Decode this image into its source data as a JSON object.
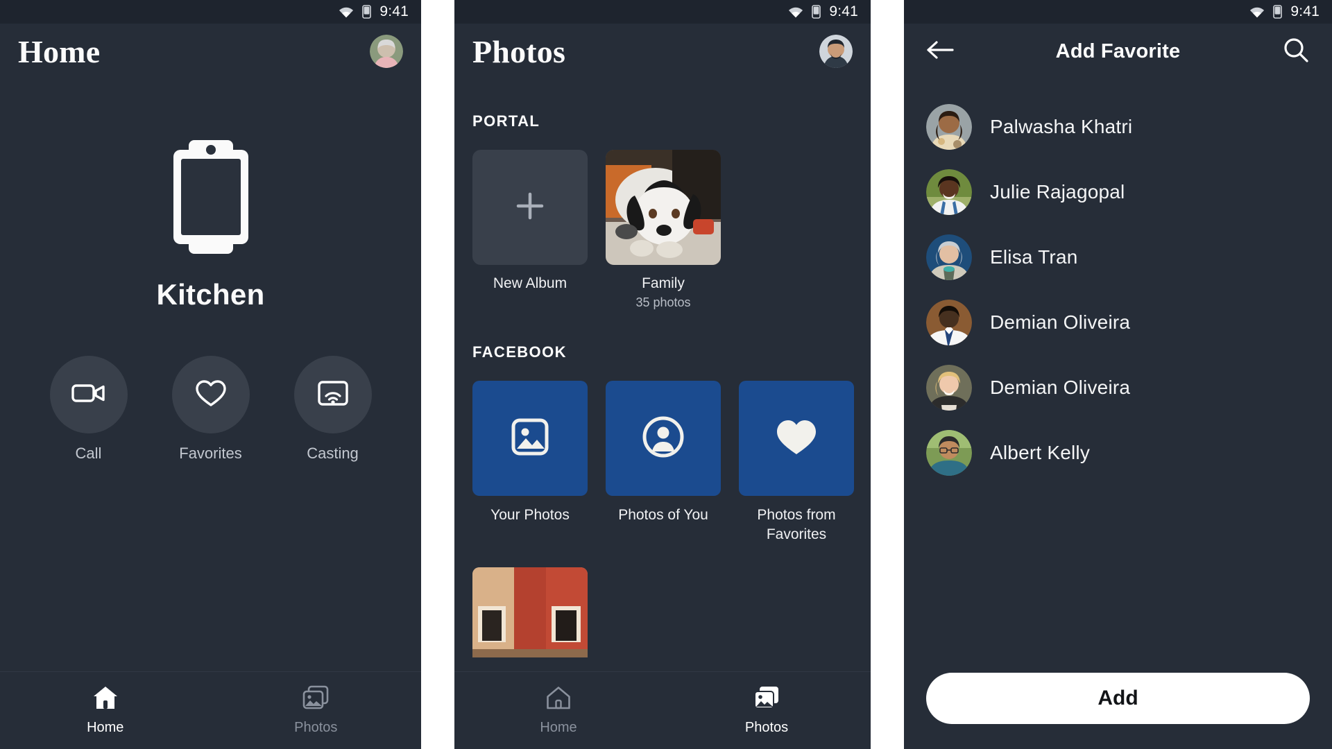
{
  "status_bar": {
    "time": "9:41",
    "wifi_icon": "wifi-icon",
    "battery_icon": "battery-icon"
  },
  "panels": [
    {
      "id": "home",
      "app_bar": {
        "title": "Home",
        "avatar_icon": "user-avatar"
      },
      "device": {
        "illustration_icon": "portal-device-icon",
        "room_name": "Kitchen"
      },
      "actions": [
        {
          "label": "Call",
          "icon": "video-camera-icon"
        },
        {
          "label": "Favorites",
          "icon": "heart-outline-icon"
        },
        {
          "label": "Casting",
          "icon": "cast-screen-icon"
        }
      ],
      "bottom_nav": [
        {
          "label": "Home",
          "icon": "home-icon",
          "active": true
        },
        {
          "label": "Photos",
          "icon": "photos-stack-icon",
          "active": false
        }
      ]
    },
    {
      "id": "photos",
      "app_bar": {
        "title": "Photos",
        "avatar_icon": "user-avatar"
      },
      "sections": [
        {
          "heading": "PORTAL",
          "albums": [
            {
              "label": "New Album",
              "sub": "",
              "icon": "plus-icon",
              "kind": "new"
            },
            {
              "label": "Family",
              "sub": "35 photos",
              "icon": "dog-photo",
              "kind": "photo"
            }
          ]
        },
        {
          "heading": "FACEBOOK",
          "tiles": [
            {
              "label": "Your Photos",
              "icon": "image-icon",
              "color": "#1B4B8F"
            },
            {
              "label": "Photos of You",
              "icon": "person-circle-icon",
              "color": "#1B4B8F"
            },
            {
              "label": "Photos from Favorites",
              "icon": "heart-filled-icon",
              "color": "#1B4B8F"
            }
          ]
        }
      ],
      "strip": [
        {
          "icon": "building-photo"
        }
      ],
      "bottom_nav": [
        {
          "label": "Home",
          "icon": "home-icon",
          "active": false
        },
        {
          "label": "Photos",
          "icon": "photos-stack-icon",
          "active": true
        }
      ]
    },
    {
      "id": "add-favorite",
      "app_bar": {
        "back_icon": "arrow-left-icon",
        "title": "Add Favorite",
        "search_icon": "search-icon"
      },
      "contacts": [
        {
          "name": "Palwasha Khatri",
          "avatar": "avatar-1"
        },
        {
          "name": "Julie Rajagopal",
          "avatar": "avatar-2"
        },
        {
          "name": "Elisa Tran",
          "avatar": "avatar-3"
        },
        {
          "name": "Demian Oliveira",
          "avatar": "avatar-4"
        },
        {
          "name": "Demian Oliveira",
          "avatar": "avatar-5"
        },
        {
          "name": "Albert Kelly",
          "avatar": "avatar-6"
        }
      ],
      "primary_button": "Add"
    }
  ],
  "colors": {
    "screen_bg": "#262D38",
    "statusbar_bg": "#1E242E",
    "surface": "#39404B",
    "facebook_blue": "#1B4B8F",
    "text_primary": "#FFFFFF",
    "text_muted": "#8A919D",
    "button_bg": "#FFFFFF"
  }
}
